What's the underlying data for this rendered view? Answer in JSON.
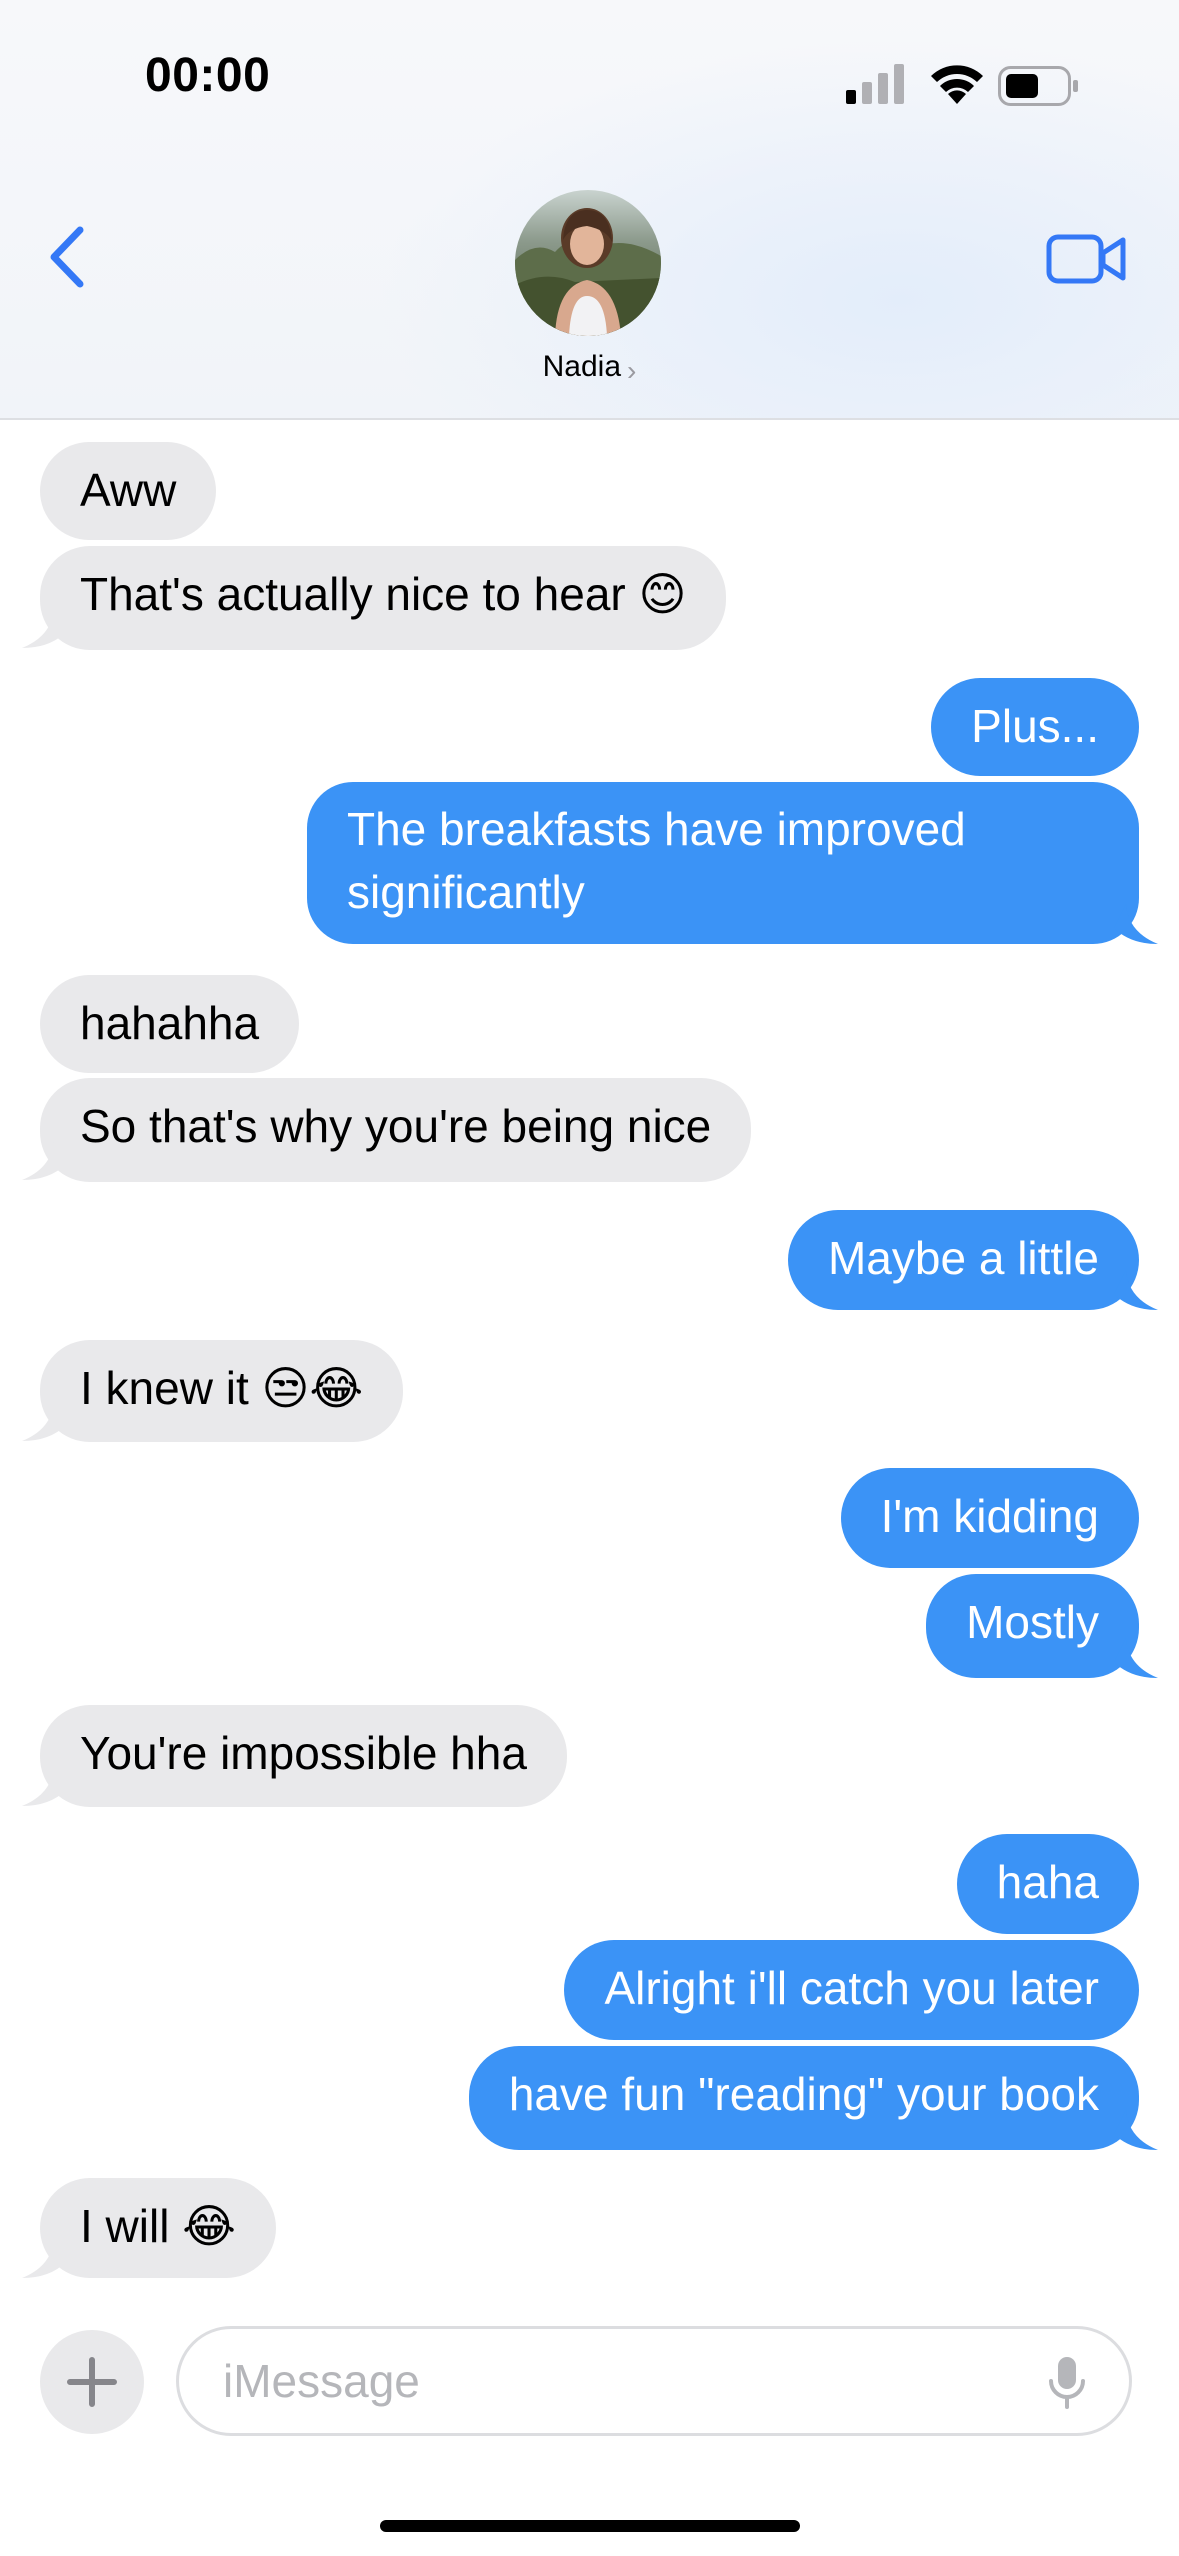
{
  "status_bar": {
    "time": "00:00"
  },
  "header": {
    "contact_name": "Nadia",
    "chevron": "›"
  },
  "icons": {
    "back": "chevron-left-icon",
    "video": "video-camera-icon",
    "plus": "plus-icon",
    "mic": "microphone-icon"
  },
  "colors": {
    "accent": "#3b93f6",
    "incoming_bubble": "#e9e9eb",
    "back_blue": "#3478f6"
  },
  "messages": [
    {
      "from": "them",
      "text": "Aww"
    },
    {
      "from": "them",
      "text": "That's actually nice to hear 😊"
    },
    {
      "from": "me",
      "text": "Plus..."
    },
    {
      "from": "me",
      "text": "The breakfasts have improved significantly"
    },
    {
      "from": "them",
      "text": "hahahha"
    },
    {
      "from": "them",
      "text": "So that's why you're being nice"
    },
    {
      "from": "me",
      "text": "Maybe a little"
    },
    {
      "from": "them",
      "text": "I knew it 😒😂"
    },
    {
      "from": "me",
      "text": "I'm kidding"
    },
    {
      "from": "me",
      "text": "Mostly"
    },
    {
      "from": "them",
      "text": "You're impossible hha"
    },
    {
      "from": "me",
      "text": "haha"
    },
    {
      "from": "me",
      "text": "Alright i'll catch you later"
    },
    {
      "from": "me",
      "text": "have fun \"reading\" your book"
    },
    {
      "from": "them",
      "text": "I will 😂"
    }
  ],
  "composer": {
    "placeholder": "iMessage"
  }
}
